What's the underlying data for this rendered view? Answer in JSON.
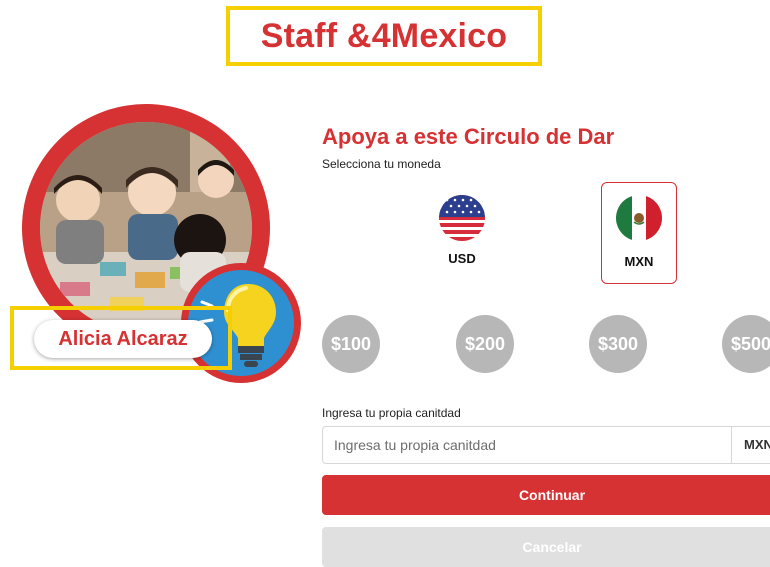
{
  "header": {
    "title": "Staff &4Mexico"
  },
  "profile": {
    "name": "Alicia Alcaraz"
  },
  "donation": {
    "heading": "Apoya a este Circulo de Dar",
    "currency_prompt": "Selecciona tu moneda",
    "currencies": [
      {
        "code": "USD",
        "icon": "us-flag-icon",
        "selected": false
      },
      {
        "code": "MXN",
        "icon": "mexico-flag-icon",
        "selected": true
      }
    ],
    "amounts": [
      "$100",
      "$200",
      "$300",
      "$500"
    ],
    "custom_amount": {
      "label": "Ingresa tu propia canitdad",
      "placeholder": "Ingresa tu propia canitdad",
      "value": "",
      "suffix": "MXN"
    },
    "continue_label": "Continuar",
    "cancel_label": "Cancelar"
  },
  "colors": {
    "brand_red": "#d63133",
    "highlight_yellow": "#f5cf00",
    "amount_gray": "#b7b7b7",
    "disabled_gray": "#e0e0e0"
  }
}
